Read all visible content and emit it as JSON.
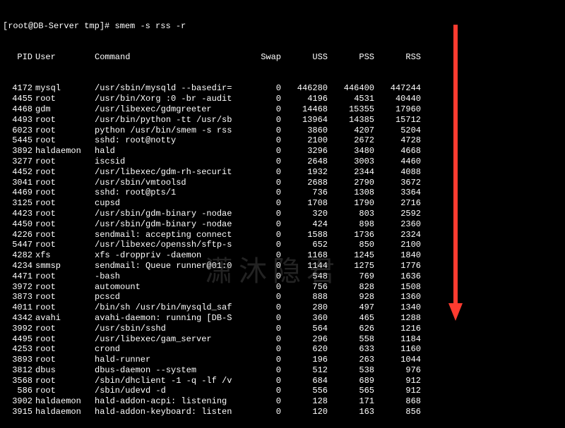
{
  "prompt": "[root@DB-Server tmp]# ",
  "command": "smem -s rss -r",
  "headers": [
    "PID",
    "User",
    "Command",
    "Swap",
    "USS",
    "PSS",
    "RSS"
  ],
  "rows": [
    {
      "pid": "4172",
      "user": "mysql",
      "cmd": "/usr/sbin/mysqld --basedir=",
      "swap": "0",
      "uss": "446280",
      "pss": "446400",
      "rss": "447244"
    },
    {
      "pid": "4455",
      "user": "root",
      "cmd": "/usr/bin/Xorg :0 -br -audit",
      "swap": "0",
      "uss": "4196",
      "pss": "4531",
      "rss": "40440"
    },
    {
      "pid": "4468",
      "user": "gdm",
      "cmd": "/usr/libexec/gdmgreeter",
      "swap": "0",
      "uss": "14468",
      "pss": "15355",
      "rss": "17960"
    },
    {
      "pid": "4493",
      "user": "root",
      "cmd": "/usr/bin/python -tt /usr/sb",
      "swap": "0",
      "uss": "13964",
      "pss": "14385",
      "rss": "15712"
    },
    {
      "pid": "6023",
      "user": "root",
      "cmd": "python /usr/bin/smem -s rss",
      "swap": "0",
      "uss": "3860",
      "pss": "4207",
      "rss": "5204"
    },
    {
      "pid": "5445",
      "user": "root",
      "cmd": "sshd: root@notty",
      "swap": "0",
      "uss": "2100",
      "pss": "2672",
      "rss": "4728"
    },
    {
      "pid": "3892",
      "user": "haldaemon",
      "cmd": "hald",
      "swap": "0",
      "uss": "3296",
      "pss": "3480",
      "rss": "4668"
    },
    {
      "pid": "3277",
      "user": "root",
      "cmd": "iscsid",
      "swap": "0",
      "uss": "2648",
      "pss": "3003",
      "rss": "4460"
    },
    {
      "pid": "4452",
      "user": "root",
      "cmd": "/usr/libexec/gdm-rh-securit",
      "swap": "0",
      "uss": "1932",
      "pss": "2344",
      "rss": "4088"
    },
    {
      "pid": "3041",
      "user": "root",
      "cmd": "/usr/sbin/vmtoolsd",
      "swap": "0",
      "uss": "2688",
      "pss": "2790",
      "rss": "3672"
    },
    {
      "pid": "4469",
      "user": "root",
      "cmd": "sshd: root@pts/1",
      "swap": "0",
      "uss": "736",
      "pss": "1308",
      "rss": "3364"
    },
    {
      "pid": "3125",
      "user": "root",
      "cmd": "cupsd",
      "swap": "0",
      "uss": "1708",
      "pss": "1790",
      "rss": "2716"
    },
    {
      "pid": "4423",
      "user": "root",
      "cmd": "/usr/sbin/gdm-binary -nodae",
      "swap": "0",
      "uss": "320",
      "pss": "803",
      "rss": "2592"
    },
    {
      "pid": "4450",
      "user": "root",
      "cmd": "/usr/sbin/gdm-binary -nodae",
      "swap": "0",
      "uss": "424",
      "pss": "898",
      "rss": "2360"
    },
    {
      "pid": "4226",
      "user": "root",
      "cmd": "sendmail: accepting connect",
      "swap": "0",
      "uss": "1588",
      "pss": "1736",
      "rss": "2324"
    },
    {
      "pid": "5447",
      "user": "root",
      "cmd": "/usr/libexec/openssh/sftp-s",
      "swap": "0",
      "uss": "652",
      "pss": "850",
      "rss": "2100"
    },
    {
      "pid": "4282",
      "user": "xfs",
      "cmd": "xfs -droppriv -daemon",
      "swap": "0",
      "uss": "1168",
      "pss": "1245",
      "rss": "1840"
    },
    {
      "pid": "4234",
      "user": "smmsp",
      "cmd": "sendmail: Queue runner@01:0",
      "swap": "0",
      "uss": "1144",
      "pss": "1275",
      "rss": "1776"
    },
    {
      "pid": "4471",
      "user": "root",
      "cmd": "-bash",
      "swap": "0",
      "uss": "548",
      "pss": "769",
      "rss": "1636"
    },
    {
      "pid": "3972",
      "user": "root",
      "cmd": "automount",
      "swap": "0",
      "uss": "756",
      "pss": "828",
      "rss": "1508"
    },
    {
      "pid": "3873",
      "user": "root",
      "cmd": "pcscd",
      "swap": "0",
      "uss": "888",
      "pss": "928",
      "rss": "1360"
    },
    {
      "pid": "4011",
      "user": "root",
      "cmd": "/bin/sh /usr/bin/mysqld_saf",
      "swap": "0",
      "uss": "280",
      "pss": "497",
      "rss": "1340"
    },
    {
      "pid": "4342",
      "user": "avahi",
      "cmd": "avahi-daemon: running [DB-S",
      "swap": "0",
      "uss": "360",
      "pss": "465",
      "rss": "1288"
    },
    {
      "pid": "3992",
      "user": "root",
      "cmd": "/usr/sbin/sshd",
      "swap": "0",
      "uss": "564",
      "pss": "626",
      "rss": "1216"
    },
    {
      "pid": "4495",
      "user": "root",
      "cmd": "/usr/libexec/gam_server",
      "swap": "0",
      "uss": "296",
      "pss": "558",
      "rss": "1184"
    },
    {
      "pid": "4253",
      "user": "root",
      "cmd": "crond",
      "swap": "0",
      "uss": "620",
      "pss": "633",
      "rss": "1160"
    },
    {
      "pid": "3893",
      "user": "root",
      "cmd": "hald-runner",
      "swap": "0",
      "uss": "196",
      "pss": "263",
      "rss": "1044"
    },
    {
      "pid": "3812",
      "user": "dbus",
      "cmd": "dbus-daemon --system",
      "swap": "0",
      "uss": "512",
      "pss": "538",
      "rss": "976"
    },
    {
      "pid": "3568",
      "user": "root",
      "cmd": "/sbin/dhclient -1 -q -lf /v",
      "swap": "0",
      "uss": "684",
      "pss": "689",
      "rss": "912"
    },
    {
      "pid": "586",
      "user": "root",
      "cmd": "/sbin/udevd -d",
      "swap": "0",
      "uss": "556",
      "pss": "565",
      "rss": "912"
    },
    {
      "pid": "3902",
      "user": "haldaemon",
      "cmd": "hald-addon-acpi: listening",
      "swap": "0",
      "uss": "128",
      "pss": "171",
      "rss": "868"
    },
    {
      "pid": "3915",
      "user": "haldaemon",
      "cmd": "hald-addon-keyboard: listen",
      "swap": "0",
      "uss": "120",
      "pss": "163",
      "rss": "856"
    }
  ],
  "watermark": "潇沐隐君"
}
